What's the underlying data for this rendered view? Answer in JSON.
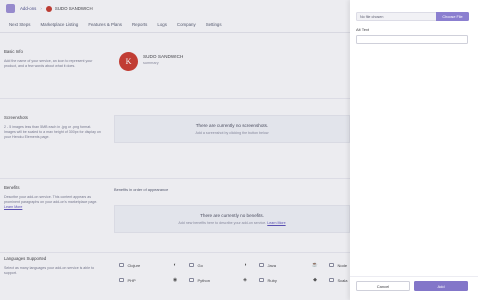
{
  "breadcrumb": {
    "root": "Add-ons",
    "separator": "›",
    "current": "SUDO SANDWICH"
  },
  "nav": {
    "tabs": [
      "Next Steps",
      "Marketplace Listing",
      "Features & Plans",
      "Reports",
      "Logs",
      "Company",
      "Settings"
    ]
  },
  "basic_info": {
    "title": "Basic Info",
    "description": "Add the name of your service, an icon to represent your product, and a few words about what it does.",
    "logo_letter": "K",
    "addon_name": "SUDO SANDWICH",
    "summary": "summary"
  },
  "screenshots": {
    "title": "Screenshots",
    "description": "2 - 5 images less than 5MB each in .jpg or .png format. Images will be scaled to a max height of 300px for display on your Heroku Elements page.",
    "empty_title": "There are currently no screenshots.",
    "empty_sub": "Add a screenshot by clicking the button below"
  },
  "benefits": {
    "title": "Benefits",
    "description": "Describe your add-on service. This content appears as prominent paragraphs on your add-on's marketplace page.",
    "learn_more": "Learn More",
    "order_label": "Benefits in order of appearance",
    "empty_title": "There are currently no benefits.",
    "empty_sub": "Add new benefits here to describe your add-on service.",
    "empty_learn_more": "Learn More"
  },
  "languages": {
    "title": "Languages Supported",
    "description": "Select as many languages your add-on service is able to support.",
    "items": [
      {
        "label": "Clojure",
        "icon": "clojure-icon",
        "glyph": "◐"
      },
      {
        "label": "Go",
        "icon": "gopher-icon",
        "glyph": "◑"
      },
      {
        "label": "Java",
        "icon": "java-icon",
        "glyph": "☕"
      },
      {
        "label": "Node",
        "icon": "node-icon",
        "glyph": "⬡"
      },
      {
        "label": "PHP",
        "icon": "php-icon",
        "glyph": "◉"
      },
      {
        "label": "Python",
        "icon": "python-icon",
        "glyph": "◈"
      },
      {
        "label": "Ruby",
        "icon": "ruby-icon",
        "glyph": "◆"
      },
      {
        "label": "Scala",
        "icon": "scala-icon",
        "glyph": "≋"
      }
    ]
  },
  "panel": {
    "file_status": "No file chosen",
    "choose_file": "Choose File",
    "alt_text_label": "Alt Text",
    "alt_text_value": "",
    "cancel_label": "Cancel",
    "add_label": "Add"
  },
  "colors": {
    "accent": "#8376c9",
    "addon_logo": "#c93d32",
    "link": "#5d52b8"
  }
}
